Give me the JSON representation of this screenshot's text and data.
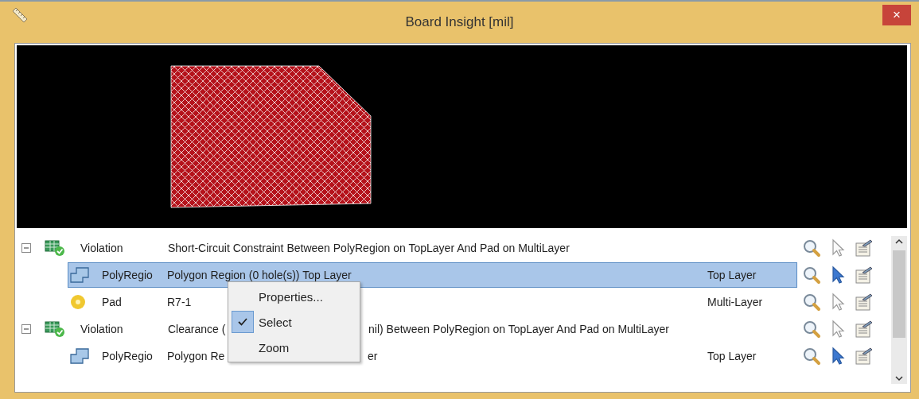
{
  "window": {
    "title": "Board Insight [mil]",
    "close": "×"
  },
  "tree": [
    {
      "kind": "violation",
      "type": "Violation",
      "description": [
        "Short-Circuit Constraint Between PolyRegion on TopLayer And Pad on MultiLayer"
      ],
      "expanded": true,
      "selected": false,
      "arrow_active": false,
      "children": [
        {
          "kind": "polygon",
          "type": "PolyRegio",
          "description": [
            "Polygon Region (0 hole(s)) Top Layer"
          ],
          "layer": "Top Layer",
          "selected": true,
          "arrow_active": true
        },
        {
          "kind": "pad",
          "type": "Pad",
          "description": [
            "R7-1"
          ],
          "layer": "Multi-Layer",
          "selected": false,
          "arrow_active": false
        }
      ]
    },
    {
      "kind": "violation",
      "type": "Violation",
      "description": [
        "Clearance (",
        "nil)  Between PolyRegion on TopLayer And Pad on MultiLayer"
      ],
      "expanded": true,
      "selected": false,
      "arrow_active": false,
      "children": [
        {
          "kind": "polygon",
          "type": "PolyRegio",
          "description": [
            "Polygon Re",
            "er"
          ],
          "layer": "Top Layer",
          "selected": false,
          "arrow_active": true
        }
      ]
    }
  ],
  "context_menu": {
    "items": [
      {
        "label": "Properties...",
        "checked": false
      },
      {
        "label": "Select",
        "checked": true
      },
      {
        "label": "Zoom",
        "checked": false
      }
    ]
  }
}
